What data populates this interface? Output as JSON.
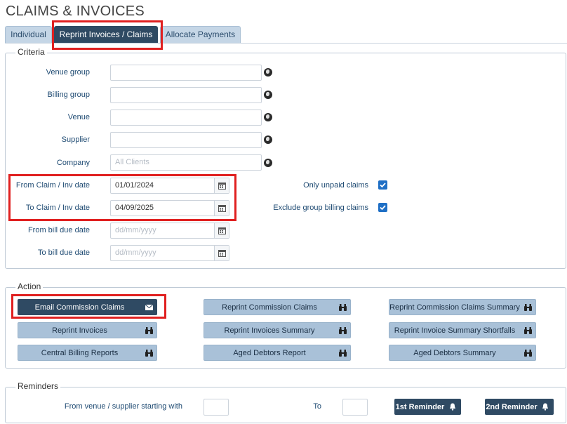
{
  "page_title": "CLAIMS & INVOICES",
  "tabs": [
    {
      "label": "Individual",
      "active": false
    },
    {
      "label": "Reprint Invoices / Claims",
      "active": true
    },
    {
      "label": "Allocate Payments",
      "active": false
    }
  ],
  "criteria": {
    "legend": "Criteria",
    "venue_group": {
      "label": "Venue group",
      "value": ""
    },
    "billing_group": {
      "label": "Billing group",
      "value": ""
    },
    "venue": {
      "label": "Venue",
      "value": ""
    },
    "supplier": {
      "label": "Supplier",
      "value": ""
    },
    "company": {
      "label": "Company",
      "placeholder": "All Clients"
    },
    "from_claim": {
      "label": "From Claim / Inv date",
      "value": "01/01/2024"
    },
    "to_claim": {
      "label": "To Claim / Inv date",
      "value": "04/09/2025"
    },
    "from_bill": {
      "label": "From bill due date",
      "placeholder": "dd/mm/yyyy"
    },
    "to_bill": {
      "label": "To bill due date",
      "placeholder": "dd/mm/yyyy"
    },
    "only_unpaid": {
      "label": "Only unpaid claims",
      "checked": true
    },
    "exclude_group": {
      "label": "Exclude group billing claims",
      "checked": true
    }
  },
  "action": {
    "legend": "Action",
    "email_commission_claims": "Email Commission Claims",
    "reprint_commission_claims": "Reprint Commission Claims",
    "reprint_commission_claims_summary": "Reprint Commission Claims Summary",
    "reprint_invoices": "Reprint Invoices",
    "reprint_invoices_summary": "Reprint Invoices Summary",
    "reprint_invoice_summary_shortfalls": "Reprint Invoice Summary Shortfalls",
    "central_billing_reports": "Central Billing Reports",
    "aged_debtors_report": "Aged Debtors Report",
    "aged_debtors_summary": "Aged Debtors Summary"
  },
  "reminders": {
    "legend": "Reminders",
    "from_label": "From venue / supplier starting with",
    "to_label": "To",
    "first_reminder": "1st Reminder",
    "second_reminder": "2nd Reminder"
  },
  "colors": {
    "accent": "#2f4a63",
    "button": "#a9c1d8",
    "highlight": "#e02020",
    "label": "#1e4a72"
  }
}
